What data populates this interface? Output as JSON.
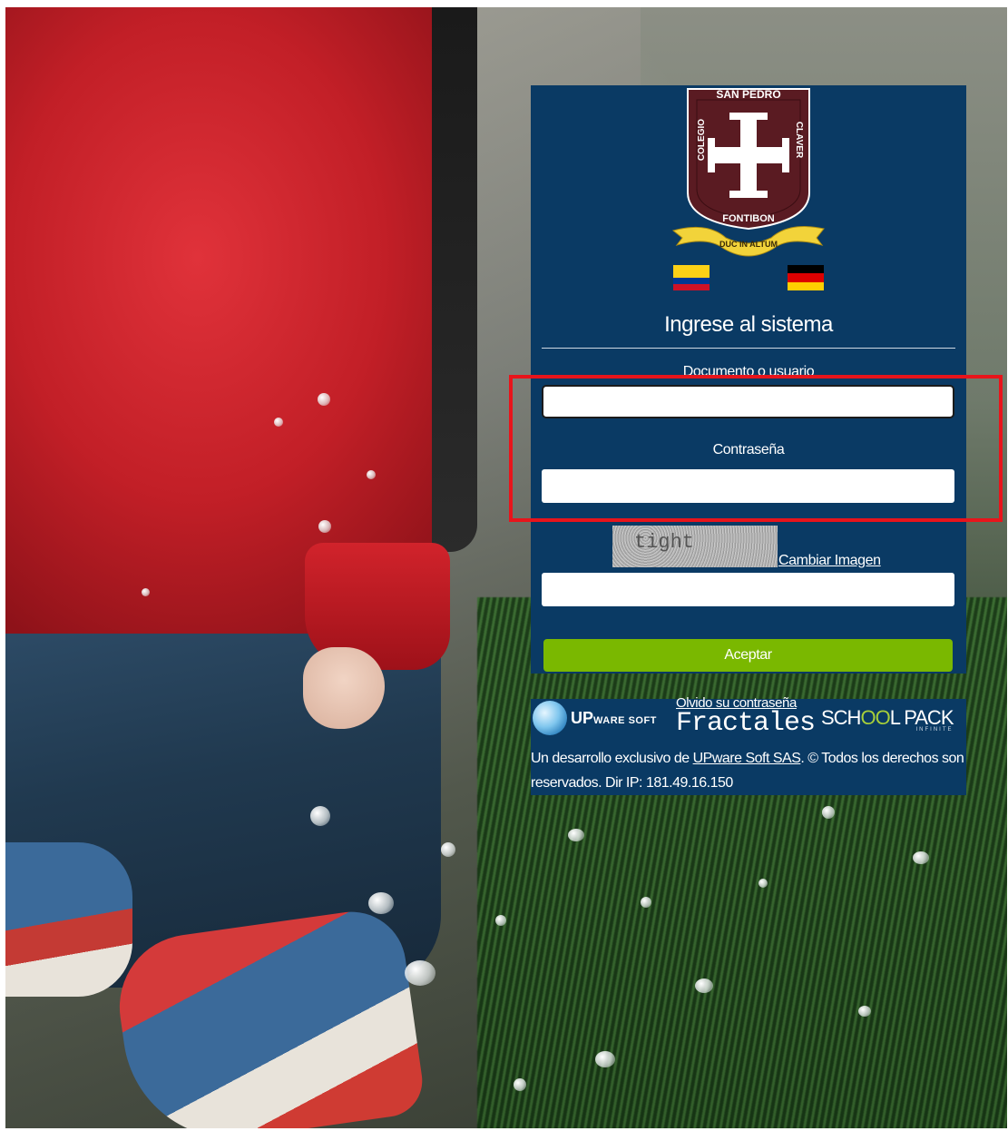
{
  "crest": {
    "top_text": "SAN PEDRO",
    "left_text": "COLEGIO",
    "right_text": "CLAVER",
    "bottom_text": "FONTIBON",
    "motto": "DUC IN ALTUM",
    "shield_color": "#5a1b22",
    "ribbon_color": "#f2d33a"
  },
  "flags": {
    "left": {
      "name": "colombia-flag",
      "colors": [
        "#fcd116",
        "#003893",
        "#ce1126"
      ]
    },
    "right": {
      "name": "germany-flag",
      "colors": [
        "#000000",
        "#dd0000",
        "#ffce00"
      ]
    }
  },
  "login": {
    "title": "Ingrese al sistema",
    "user_label": "Documento o usuario",
    "user_value": "",
    "password_label": "Contraseña",
    "password_value": "",
    "captcha_text": "tight",
    "captcha_link": "Cambiar Imagen",
    "captcha_value": "",
    "accept_label": "Aceptar"
  },
  "footer": {
    "forgot_link": "Olvido su contraseña",
    "logo_upware": "UP",
    "logo_upware_small": "WARE SOFT",
    "logo_fractales": "Fractales",
    "logo_schoolpack_a": "SCH",
    "logo_schoolpack_oo": "OO",
    "logo_schoolpack_b": "L PACK",
    "logo_schoolpack_sub": "INFINITE",
    "credits_prefix": "Un desarrollo exclusivo de ",
    "credits_company": "UPware Soft SAS",
    "credits_rights": ". © Todos los derechos son reservados.",
    "ip_label": "Dir IP: ",
    "ip_value": "181.49.16.150"
  },
  "colors": {
    "panel_bg": "#0a3a64",
    "accept_bg": "#7ab800",
    "highlight": "#e8141b"
  }
}
